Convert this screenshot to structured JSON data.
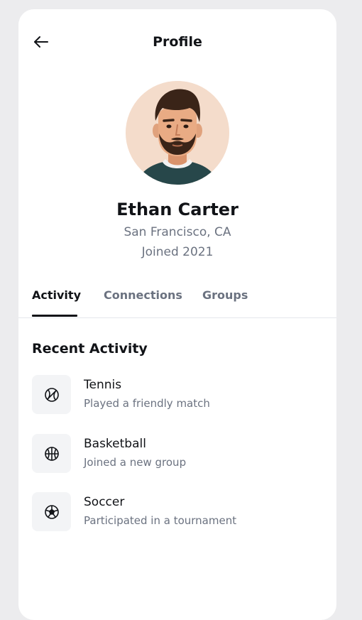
{
  "header": {
    "title": "Profile",
    "back_icon": "arrow-left-icon"
  },
  "profile": {
    "name": "Ethan Carter",
    "location": "San Francisco, CA",
    "joined": "Joined 2021",
    "avatar_icon": "avatar-illustration"
  },
  "tabs": [
    {
      "label": "Activity",
      "active": true
    },
    {
      "label": "Connections",
      "active": false
    },
    {
      "label": "Groups",
      "active": false
    }
  ],
  "recent_activity": {
    "title": "Recent Activity",
    "items": [
      {
        "title": "Tennis",
        "description": "Played a friendly match",
        "icon": "tennis-ball-icon"
      },
      {
        "title": "Basketball",
        "description": "Joined a new group",
        "icon": "basketball-icon"
      },
      {
        "title": "Soccer",
        "description": "Participated in a tournament",
        "icon": "soccer-ball-icon"
      }
    ]
  },
  "colors": {
    "background": "#ececee",
    "card": "#ffffff",
    "text_primary": "#111317",
    "text_secondary": "#6b7280",
    "icon_box": "#f3f4f6",
    "avatar_bg": "#f4dccb",
    "shirt": "#27474a",
    "hair": "#3a2418"
  }
}
